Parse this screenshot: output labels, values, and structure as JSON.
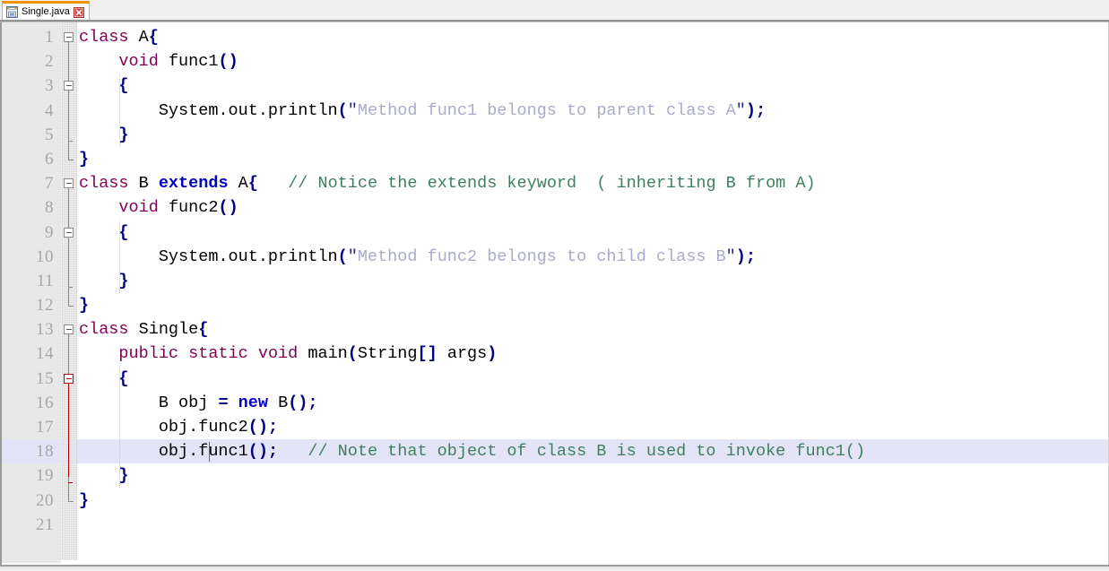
{
  "window": {
    "title": "Single.java",
    "accent_orange": "#f29400",
    "highlight_line_color": "#e4e4f8",
    "fold_active_color": "#c00000"
  },
  "tab": {
    "label": "Single.java",
    "save_icon": "disk-icon",
    "close_icon": "close-icon"
  },
  "editor": {
    "line_numbers": [
      "1",
      "2",
      "3",
      "4",
      "5",
      "6",
      "7",
      "8",
      "9",
      "10",
      "11",
      "12",
      "13",
      "14",
      "15",
      "16",
      "17",
      "18",
      "19",
      "20",
      "21"
    ],
    "current_line": 18,
    "caret": {
      "line": 18,
      "column": 13
    },
    "lines": [
      {
        "n": 1,
        "indent": 0,
        "tokens": [
          {
            "t": "class",
            "c": "kw"
          },
          {
            "t": " ",
            "c": "plain"
          },
          {
            "t": "A",
            "c": "plain"
          },
          {
            "t": "{",
            "c": "punct"
          }
        ]
      },
      {
        "n": 2,
        "indent": 0,
        "tokens": [
          {
            "t": "    ",
            "c": "plain"
          },
          {
            "t": "void",
            "c": "kw"
          },
          {
            "t": " func1",
            "c": "plain"
          },
          {
            "t": "()",
            "c": "punct"
          }
        ]
      },
      {
        "n": 3,
        "indent": 0,
        "tokens": [
          {
            "t": "    ",
            "c": "plain"
          },
          {
            "t": "{",
            "c": "punct"
          }
        ]
      },
      {
        "n": 4,
        "indent": 0,
        "tokens": [
          {
            "t": "        System.out.println",
            "c": "plain"
          },
          {
            "t": "(",
            "c": "punct"
          },
          {
            "t": "\"",
            "c": "strq"
          },
          {
            "t": "Method func1 belongs to parent class A",
            "c": "str"
          },
          {
            "t": "\"",
            "c": "strq"
          },
          {
            "t": ");",
            "c": "punct"
          }
        ]
      },
      {
        "n": 5,
        "indent": 0,
        "tokens": [
          {
            "t": "    ",
            "c": "plain"
          },
          {
            "t": "}",
            "c": "punct"
          }
        ]
      },
      {
        "n": 6,
        "indent": 0,
        "tokens": [
          {
            "t": "}",
            "c": "punct"
          }
        ]
      },
      {
        "n": 7,
        "indent": 0,
        "tokens": [
          {
            "t": "class",
            "c": "kw"
          },
          {
            "t": " B ",
            "c": "plain"
          },
          {
            "t": "extends",
            "c": "kw-b"
          },
          {
            "t": " A",
            "c": "plain"
          },
          {
            "t": "{",
            "c": "punct"
          },
          {
            "t": "   ",
            "c": "plain"
          },
          {
            "t": "// Notice the extends keyword  ( inheriting B from A)",
            "c": "cmt"
          }
        ]
      },
      {
        "n": 8,
        "indent": 0,
        "tokens": [
          {
            "t": "    ",
            "c": "plain"
          },
          {
            "t": "void",
            "c": "kw"
          },
          {
            "t": " func2",
            "c": "plain"
          },
          {
            "t": "()",
            "c": "punct"
          }
        ]
      },
      {
        "n": 9,
        "indent": 0,
        "tokens": [
          {
            "t": "    ",
            "c": "plain"
          },
          {
            "t": "{",
            "c": "punct"
          }
        ]
      },
      {
        "n": 10,
        "indent": 0,
        "tokens": [
          {
            "t": "        System.out.println",
            "c": "plain"
          },
          {
            "t": "(",
            "c": "punct"
          },
          {
            "t": "\"",
            "c": "strq"
          },
          {
            "t": "Method func2 belongs to child class B",
            "c": "str"
          },
          {
            "t": "\"",
            "c": "strq"
          },
          {
            "t": ");",
            "c": "punct"
          }
        ]
      },
      {
        "n": 11,
        "indent": 0,
        "tokens": [
          {
            "t": "    ",
            "c": "plain"
          },
          {
            "t": "}",
            "c": "punct"
          }
        ]
      },
      {
        "n": 12,
        "indent": 0,
        "tokens": [
          {
            "t": "}",
            "c": "punct"
          }
        ]
      },
      {
        "n": 13,
        "indent": 0,
        "tokens": [
          {
            "t": "class",
            "c": "kw"
          },
          {
            "t": " Single",
            "c": "plain"
          },
          {
            "t": "{",
            "c": "punct"
          }
        ]
      },
      {
        "n": 14,
        "indent": 0,
        "tokens": [
          {
            "t": "    ",
            "c": "plain"
          },
          {
            "t": "public static void",
            "c": "kw"
          },
          {
            "t": " main",
            "c": "plain"
          },
          {
            "t": "(",
            "c": "punct"
          },
          {
            "t": "String",
            "c": "plain"
          },
          {
            "t": "[]",
            "c": "punct"
          },
          {
            "t": " args",
            "c": "plain"
          },
          {
            "t": ")",
            "c": "punct"
          }
        ]
      },
      {
        "n": 15,
        "indent": 0,
        "tokens": [
          {
            "t": "    ",
            "c": "plain"
          },
          {
            "t": "{",
            "c": "punct"
          }
        ]
      },
      {
        "n": 16,
        "indent": 0,
        "tokens": [
          {
            "t": "        B obj ",
            "c": "plain"
          },
          {
            "t": "=",
            "c": "punct"
          },
          {
            "t": " ",
            "c": "plain"
          },
          {
            "t": "new",
            "c": "kw-b"
          },
          {
            "t": " B",
            "c": "plain"
          },
          {
            "t": "();",
            "c": "punct"
          }
        ]
      },
      {
        "n": 17,
        "indent": 0,
        "tokens": [
          {
            "t": "        obj.func2",
            "c": "plain"
          },
          {
            "t": "();",
            "c": "punct"
          }
        ]
      },
      {
        "n": 18,
        "indent": 0,
        "tokens": [
          {
            "t": "        obj.func1",
            "c": "plain"
          },
          {
            "t": "();",
            "c": "punct"
          },
          {
            "t": "   ",
            "c": "plain"
          },
          {
            "t": "// Note that object of class B is used to invoke func1()",
            "c": "cmt"
          }
        ]
      },
      {
        "n": 19,
        "indent": 0,
        "tokens": [
          {
            "t": "    ",
            "c": "plain"
          },
          {
            "t": "}",
            "c": "punct"
          }
        ]
      },
      {
        "n": 20,
        "indent": 0,
        "tokens": [
          {
            "t": "}",
            "c": "punct"
          }
        ]
      },
      {
        "n": 21,
        "indent": 0,
        "tokens": []
      }
    ],
    "folding": [
      {
        "line": 1,
        "type": "collapse-box",
        "state": "expanded",
        "active": false
      },
      {
        "line": 3,
        "type": "collapse-box",
        "state": "expanded",
        "active": false
      },
      {
        "line": 6,
        "type": "block-end",
        "active": false
      },
      {
        "line": 7,
        "type": "collapse-box",
        "state": "expanded",
        "active": false
      },
      {
        "line": 9,
        "type": "collapse-box",
        "state": "expanded",
        "active": false
      },
      {
        "line": 12,
        "type": "block-end",
        "active": false
      },
      {
        "line": 13,
        "type": "collapse-box",
        "state": "expanded",
        "active": false
      },
      {
        "line": 15,
        "type": "collapse-box",
        "state": "expanded",
        "active": true
      },
      {
        "line": 20,
        "type": "block-end",
        "active": false
      }
    ]
  }
}
